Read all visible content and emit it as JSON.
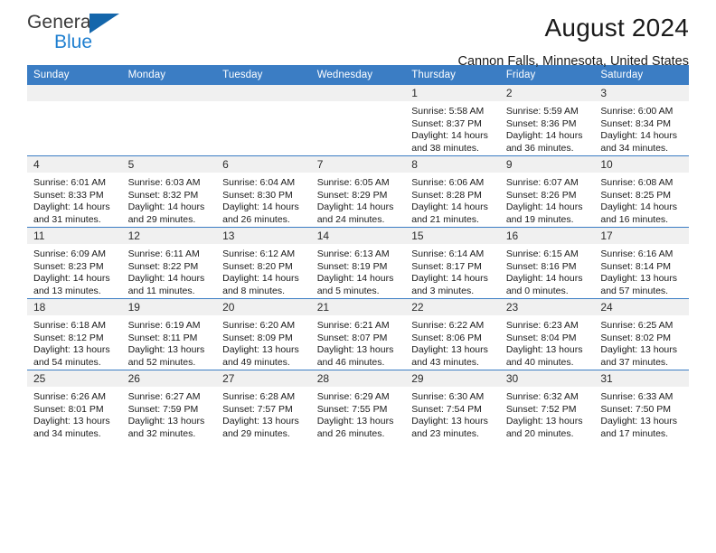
{
  "brand": {
    "name_top": "General",
    "name_bottom": "Blue",
    "triangle_color": "#1466ab",
    "blue_color": "#1f7fd0"
  },
  "header": {
    "title": "August 2024",
    "location": "Cannon Falls, Minnesota, United States"
  },
  "theme": {
    "header_bg": "#3b7dc4",
    "daynum_bg": "#f0f0f0",
    "grid_line": "#3b7dc4"
  },
  "weekday_headers": [
    "Sunday",
    "Monday",
    "Tuesday",
    "Wednesday",
    "Thursday",
    "Friday",
    "Saturday"
  ],
  "labels": {
    "sunrise_prefix": "Sunrise:",
    "sunset_prefix": "Sunset:",
    "daylight_prefix": "Daylight:"
  },
  "weeks": [
    [
      {
        "day": "",
        "empty": true
      },
      {
        "day": "",
        "empty": true
      },
      {
        "day": "",
        "empty": true
      },
      {
        "day": "",
        "empty": true
      },
      {
        "day": "1",
        "sunrise": "Sunrise: 5:58 AM",
        "sunset": "Sunset: 8:37 PM",
        "daylight_1": "Daylight: 14 hours",
        "daylight_2": "and 38 minutes."
      },
      {
        "day": "2",
        "sunrise": "Sunrise: 5:59 AM",
        "sunset": "Sunset: 8:36 PM",
        "daylight_1": "Daylight: 14 hours",
        "daylight_2": "and 36 minutes."
      },
      {
        "day": "3",
        "sunrise": "Sunrise: 6:00 AM",
        "sunset": "Sunset: 8:34 PM",
        "daylight_1": "Daylight: 14 hours",
        "daylight_2": "and 34 minutes."
      }
    ],
    [
      {
        "day": "4",
        "sunrise": "Sunrise: 6:01 AM",
        "sunset": "Sunset: 8:33 PM",
        "daylight_1": "Daylight: 14 hours",
        "daylight_2": "and 31 minutes."
      },
      {
        "day": "5",
        "sunrise": "Sunrise: 6:03 AM",
        "sunset": "Sunset: 8:32 PM",
        "daylight_1": "Daylight: 14 hours",
        "daylight_2": "and 29 minutes."
      },
      {
        "day": "6",
        "sunrise": "Sunrise: 6:04 AM",
        "sunset": "Sunset: 8:30 PM",
        "daylight_1": "Daylight: 14 hours",
        "daylight_2": "and 26 minutes."
      },
      {
        "day": "7",
        "sunrise": "Sunrise: 6:05 AM",
        "sunset": "Sunset: 8:29 PM",
        "daylight_1": "Daylight: 14 hours",
        "daylight_2": "and 24 minutes."
      },
      {
        "day": "8",
        "sunrise": "Sunrise: 6:06 AM",
        "sunset": "Sunset: 8:28 PM",
        "daylight_1": "Daylight: 14 hours",
        "daylight_2": "and 21 minutes."
      },
      {
        "day": "9",
        "sunrise": "Sunrise: 6:07 AM",
        "sunset": "Sunset: 8:26 PM",
        "daylight_1": "Daylight: 14 hours",
        "daylight_2": "and 19 minutes."
      },
      {
        "day": "10",
        "sunrise": "Sunrise: 6:08 AM",
        "sunset": "Sunset: 8:25 PM",
        "daylight_1": "Daylight: 14 hours",
        "daylight_2": "and 16 minutes."
      }
    ],
    [
      {
        "day": "11",
        "sunrise": "Sunrise: 6:09 AM",
        "sunset": "Sunset: 8:23 PM",
        "daylight_1": "Daylight: 14 hours",
        "daylight_2": "and 13 minutes."
      },
      {
        "day": "12",
        "sunrise": "Sunrise: 6:11 AM",
        "sunset": "Sunset: 8:22 PM",
        "daylight_1": "Daylight: 14 hours",
        "daylight_2": "and 11 minutes."
      },
      {
        "day": "13",
        "sunrise": "Sunrise: 6:12 AM",
        "sunset": "Sunset: 8:20 PM",
        "daylight_1": "Daylight: 14 hours",
        "daylight_2": "and 8 minutes."
      },
      {
        "day": "14",
        "sunrise": "Sunrise: 6:13 AM",
        "sunset": "Sunset: 8:19 PM",
        "daylight_1": "Daylight: 14 hours",
        "daylight_2": "and 5 minutes."
      },
      {
        "day": "15",
        "sunrise": "Sunrise: 6:14 AM",
        "sunset": "Sunset: 8:17 PM",
        "daylight_1": "Daylight: 14 hours",
        "daylight_2": "and 3 minutes."
      },
      {
        "day": "16",
        "sunrise": "Sunrise: 6:15 AM",
        "sunset": "Sunset: 8:16 PM",
        "daylight_1": "Daylight: 14 hours",
        "daylight_2": "and 0 minutes."
      },
      {
        "day": "17",
        "sunrise": "Sunrise: 6:16 AM",
        "sunset": "Sunset: 8:14 PM",
        "daylight_1": "Daylight: 13 hours",
        "daylight_2": "and 57 minutes."
      }
    ],
    [
      {
        "day": "18",
        "sunrise": "Sunrise: 6:18 AM",
        "sunset": "Sunset: 8:12 PM",
        "daylight_1": "Daylight: 13 hours",
        "daylight_2": "and 54 minutes."
      },
      {
        "day": "19",
        "sunrise": "Sunrise: 6:19 AM",
        "sunset": "Sunset: 8:11 PM",
        "daylight_1": "Daylight: 13 hours",
        "daylight_2": "and 52 minutes."
      },
      {
        "day": "20",
        "sunrise": "Sunrise: 6:20 AM",
        "sunset": "Sunset: 8:09 PM",
        "daylight_1": "Daylight: 13 hours",
        "daylight_2": "and 49 minutes."
      },
      {
        "day": "21",
        "sunrise": "Sunrise: 6:21 AM",
        "sunset": "Sunset: 8:07 PM",
        "daylight_1": "Daylight: 13 hours",
        "daylight_2": "and 46 minutes."
      },
      {
        "day": "22",
        "sunrise": "Sunrise: 6:22 AM",
        "sunset": "Sunset: 8:06 PM",
        "daylight_1": "Daylight: 13 hours",
        "daylight_2": "and 43 minutes."
      },
      {
        "day": "23",
        "sunrise": "Sunrise: 6:23 AM",
        "sunset": "Sunset: 8:04 PM",
        "daylight_1": "Daylight: 13 hours",
        "daylight_2": "and 40 minutes."
      },
      {
        "day": "24",
        "sunrise": "Sunrise: 6:25 AM",
        "sunset": "Sunset: 8:02 PM",
        "daylight_1": "Daylight: 13 hours",
        "daylight_2": "and 37 minutes."
      }
    ],
    [
      {
        "day": "25",
        "sunrise": "Sunrise: 6:26 AM",
        "sunset": "Sunset: 8:01 PM",
        "daylight_1": "Daylight: 13 hours",
        "daylight_2": "and 34 minutes."
      },
      {
        "day": "26",
        "sunrise": "Sunrise: 6:27 AM",
        "sunset": "Sunset: 7:59 PM",
        "daylight_1": "Daylight: 13 hours",
        "daylight_2": "and 32 minutes."
      },
      {
        "day": "27",
        "sunrise": "Sunrise: 6:28 AM",
        "sunset": "Sunset: 7:57 PM",
        "daylight_1": "Daylight: 13 hours",
        "daylight_2": "and 29 minutes."
      },
      {
        "day": "28",
        "sunrise": "Sunrise: 6:29 AM",
        "sunset": "Sunset: 7:55 PM",
        "daylight_1": "Daylight: 13 hours",
        "daylight_2": "and 26 minutes."
      },
      {
        "day": "29",
        "sunrise": "Sunrise: 6:30 AM",
        "sunset": "Sunset: 7:54 PM",
        "daylight_1": "Daylight: 13 hours",
        "daylight_2": "and 23 minutes."
      },
      {
        "day": "30",
        "sunrise": "Sunrise: 6:32 AM",
        "sunset": "Sunset: 7:52 PM",
        "daylight_1": "Daylight: 13 hours",
        "daylight_2": "and 20 minutes."
      },
      {
        "day": "31",
        "sunrise": "Sunrise: 6:33 AM",
        "sunset": "Sunset: 7:50 PM",
        "daylight_1": "Daylight: 13 hours",
        "daylight_2": "and 17 minutes."
      }
    ]
  ]
}
